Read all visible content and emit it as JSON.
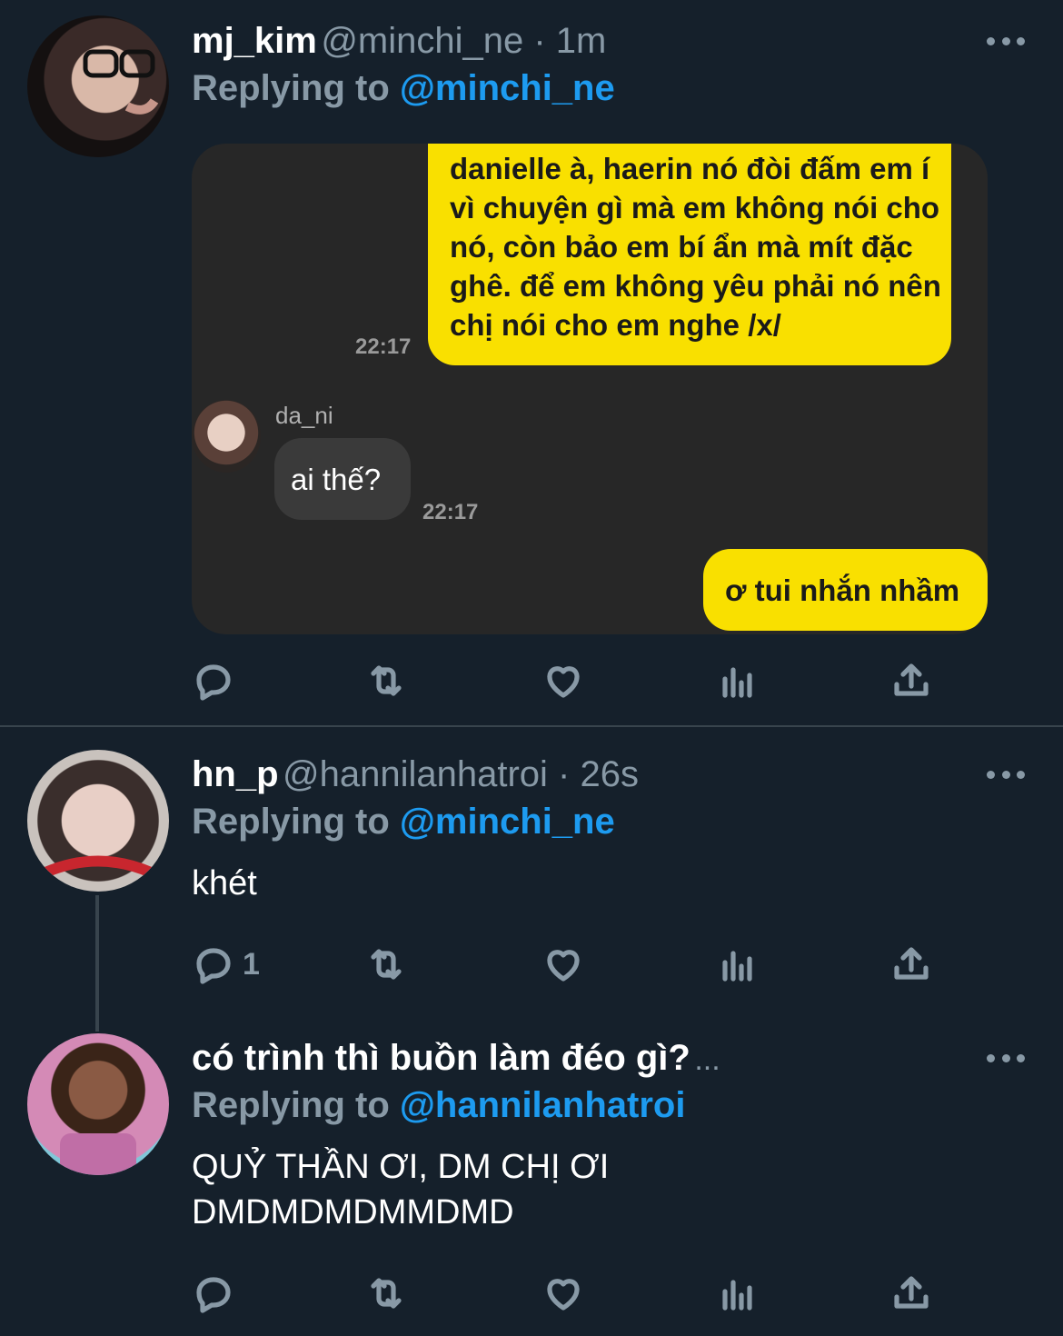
{
  "tweets": [
    {
      "name": "mj_kim",
      "handle": "@minchi_ne",
      "time_sep": " · 1m",
      "replying_prefix": "Replying to ",
      "replying_to": "@minchi_ne",
      "chat": {
        "msg1": "danielle à, haerin nó đòi đấm em í vì chuyện gì mà em không nói cho nó, còn bảo em bí ẩn mà mít đặc ghê. để em không yêu phải nó nên chị nói cho em nghe /x/",
        "time1": "22:17",
        "other_name": "da_ni",
        "msg2": "ai thế?",
        "time2": "22:17",
        "msg3": "ơ tui nhắn nhầm"
      }
    },
    {
      "name": "hn_p",
      "handle": "@hannilanhatroi",
      "time_sep": " · 26s",
      "replying_prefix": "Replying to ",
      "replying_to": "@minchi_ne",
      "text": "khét",
      "reply_count": "1"
    },
    {
      "name": "có trình thì buồn làm đéo gì?",
      "ellipsis": "...",
      "replying_prefix": "Replying to ",
      "replying_to": "@hannilanhatroi",
      "text_line1": "QUỶ THẦN ƠI, DM CHỊ ƠI",
      "text_line2": "DMDMDMDMMDMD"
    }
  ],
  "colors": {
    "background": "#15202b",
    "muted": "#8899a6",
    "link": "#1d9bf0",
    "chat_bg": "#272727",
    "bubble_yellow": "#f9e000"
  },
  "icons": [
    "reply-icon",
    "retweet-icon",
    "like-icon",
    "analytics-icon",
    "share-icon",
    "more-icon"
  ]
}
